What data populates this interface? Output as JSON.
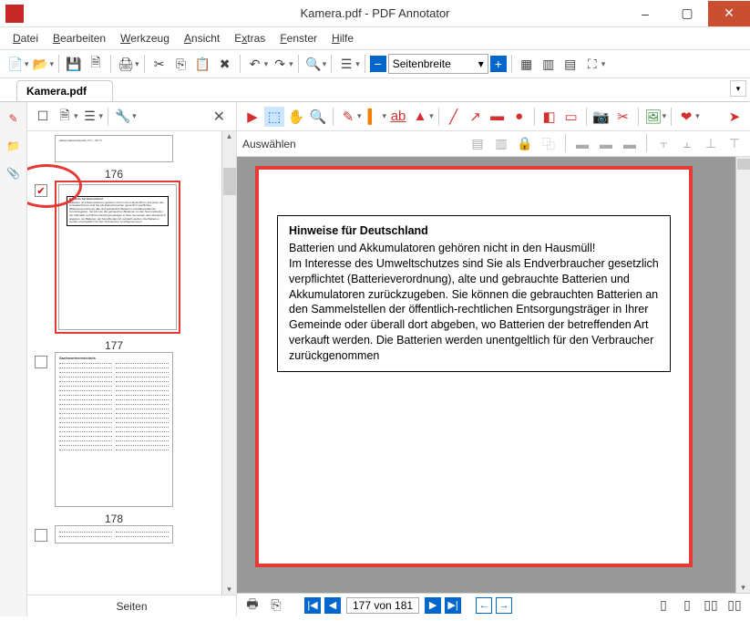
{
  "window": {
    "title": "Kamera.pdf - PDF Annotator",
    "min": "–",
    "max": "▢",
    "close": "✕"
  },
  "menu": {
    "file": "Datei",
    "edit": "Bearbeiten",
    "tool": "Werkzeug",
    "view": "Ansicht",
    "extras": "Extras",
    "window": "Fenster",
    "help": "Hilfe"
  },
  "toolbar": {
    "zoom_mode": "Seitenbreite"
  },
  "doctab": {
    "name": "Kamera.pdf"
  },
  "subbar": {
    "select": "Auswählen"
  },
  "sidebar": {
    "footer": "Seiten",
    "pages": [
      "176",
      "177",
      "178"
    ]
  },
  "page": {
    "title": "Hinweise für Deutschland",
    "body": "Batterien und Akkumulatoren gehören nicht in den Hausmüll!\nIm Interesse des Umweltschutzes sind Sie als Endverbraucher gesetzlich verpflichtet (Batterieverordnung), alte und gebrauchte Batterien und Akkumulatoren zurückzugeben. Sie können die gebrauchten Batterien an den Sammelstellen der öffentlich-rechtlichen Entsorgungsträger in Ihrer Gemeinde oder überall dort abgeben, wo Batterien der betreffenden Art verkauft werden. Die Batterien werden unentgeltlich für den Verbraucher zurückgenommen"
  },
  "status": {
    "page_info": "177 von 181"
  }
}
